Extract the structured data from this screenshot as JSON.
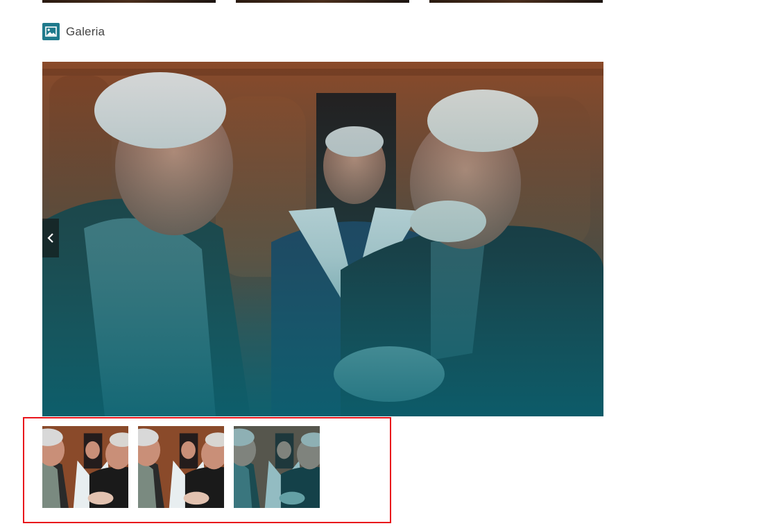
{
  "section": {
    "title": "Galeria",
    "icon": "image-icon"
  },
  "gallery": {
    "main_image_alt": "",
    "thumbnails_count": 3,
    "prev_icon": "chevron-left-icon"
  },
  "colors": {
    "accent": "#1f7a8c",
    "highlight_border": "#e8141b"
  }
}
